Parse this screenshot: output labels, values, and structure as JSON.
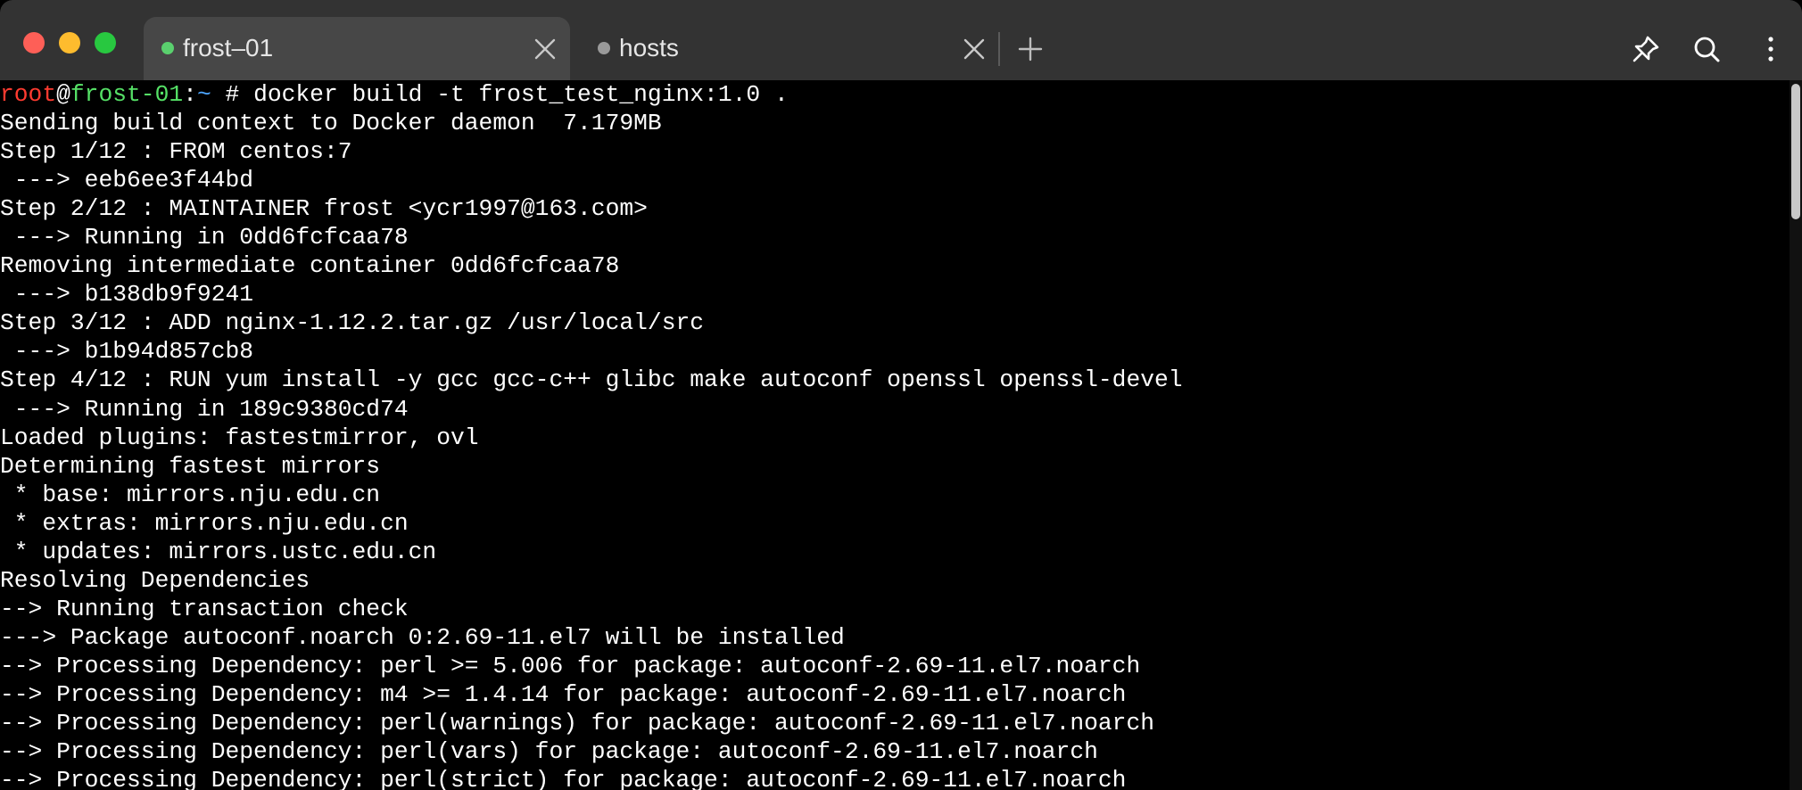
{
  "tabs": [
    {
      "title": "frost–01",
      "status": "connected",
      "dot_color": "#5ad06e",
      "active": true
    },
    {
      "title": "hosts",
      "status": "idle",
      "dot_color": "#9a9a9a",
      "active": false
    }
  ],
  "toolbar": {
    "new_tab_icon": "plus-icon",
    "pin_icon": "pin-icon",
    "search_icon": "search-icon",
    "menu_icon": "vertical-ellipsis-icon"
  },
  "terminal": {
    "prompt": {
      "user": "root",
      "at": "@",
      "host": "frost-01",
      "colon": ":",
      "path": "~",
      "symbol": " # ",
      "command": "docker build -t frost_test_nginx:1.0 ."
    },
    "output": [
      "Sending build context to Docker daemon  7.179MB",
      "Step 1/12 : FROM centos:7",
      " ---> eeb6ee3f44bd",
      "Step 2/12 : MAINTAINER frost <ycr1997@163.com>",
      " ---> Running in 0dd6fcfcaa78",
      "Removing intermediate container 0dd6fcfcaa78",
      " ---> b138db9f9241",
      "Step 3/12 : ADD nginx-1.12.2.tar.gz /usr/local/src",
      " ---> b1b94d857cb8",
      "Step 4/12 : RUN yum install -y gcc gcc-c++ glibc make autoconf openssl openssl-devel",
      " ---> Running in 189c9380cd74",
      "Loaded plugins: fastestmirror, ovl",
      "Determining fastest mirrors",
      " * base: mirrors.nju.edu.cn",
      " * extras: mirrors.nju.edu.cn",
      " * updates: mirrors.ustc.edu.cn",
      "Resolving Dependencies",
      "--> Running transaction check",
      "---> Package autoconf.noarch 0:2.69-11.el7 will be installed",
      "--> Processing Dependency: perl >= 5.006 for package: autoconf-2.69-11.el7.noarch",
      "--> Processing Dependency: m4 >= 1.4.14 for package: autoconf-2.69-11.el7.noarch",
      "--> Processing Dependency: perl(warnings) for package: autoconf-2.69-11.el7.noarch",
      "--> Processing Dependency: perl(vars) for package: autoconf-2.69-11.el7.noarch",
      "--> Processing Dependency: perl(strict) for package: autoconf-2.69-11.el7.noarch"
    ]
  },
  "colors": {
    "titlebar_bg": "#333333",
    "active_tab_bg": "#474747",
    "terminal_bg": "#000000",
    "terminal_fg": "#ffffff",
    "prompt_user": "#ff3b30",
    "prompt_host": "#55e066",
    "prompt_path": "#4da6ff"
  }
}
